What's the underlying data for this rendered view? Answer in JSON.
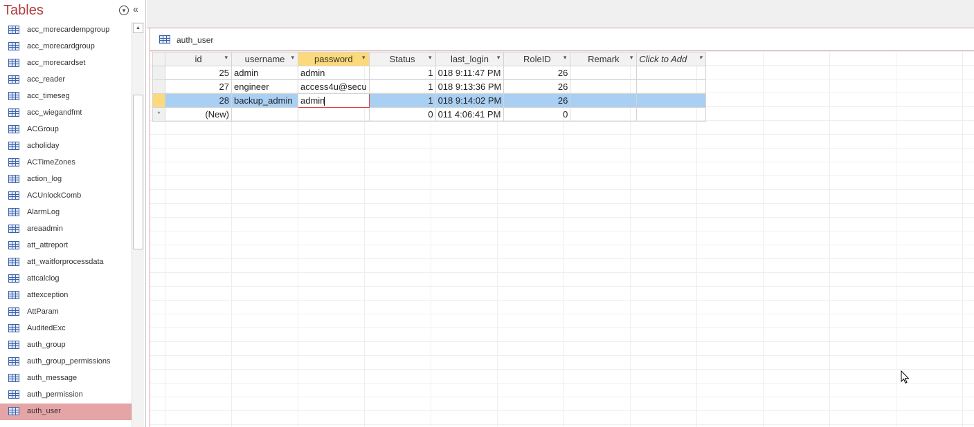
{
  "nav": {
    "title": "Tables",
    "items": [
      {
        "label": "acc_morecardempgroup"
      },
      {
        "label": "acc_morecardgroup"
      },
      {
        "label": "acc_morecardset"
      },
      {
        "label": "acc_reader"
      },
      {
        "label": "acc_timeseg"
      },
      {
        "label": "acc_wiegandfmt"
      },
      {
        "label": "ACGroup"
      },
      {
        "label": "acholiday"
      },
      {
        "label": "ACTimeZones"
      },
      {
        "label": "action_log"
      },
      {
        "label": "ACUnlockComb"
      },
      {
        "label": "AlarmLog"
      },
      {
        "label": "areaadmin"
      },
      {
        "label": "att_attreport"
      },
      {
        "label": "att_waitforprocessdata"
      },
      {
        "label": "attcalclog"
      },
      {
        "label": "attexception"
      },
      {
        "label": "AttParam"
      },
      {
        "label": "AuditedExc"
      },
      {
        "label": "auth_group"
      },
      {
        "label": "auth_group_permissions"
      },
      {
        "label": "auth_message"
      },
      {
        "label": "auth_permission"
      },
      {
        "label": "auth_user",
        "selected": true
      }
    ]
  },
  "doc": {
    "tab_label": "auth_user"
  },
  "grid": {
    "columns": [
      "id",
      "username",
      "password",
      "Status",
      "last_login",
      "RoleID",
      "Remark",
      "Click to Add"
    ],
    "rows": [
      {
        "id": "25",
        "username": "admin",
        "password": "admin",
        "status": "1",
        "last_login": "018 9:11:47 PM",
        "roleid": "26",
        "remark": ""
      },
      {
        "id": "27",
        "username": "engineer",
        "password": "access4u@secu",
        "status": "1",
        "last_login": "018 9:13:36 PM",
        "roleid": "26",
        "remark": ""
      },
      {
        "id": "28",
        "username": "backup_admin",
        "password": "admin",
        "status": "1",
        "last_login": "018 9:14:02 PM",
        "roleid": "26",
        "remark": ""
      }
    ],
    "new_row": {
      "id": "(New)",
      "status": "0",
      "last_login": "011 4:06:41 PM",
      "roleid": "0",
      "new_marker": "*"
    }
  },
  "colors": {
    "accent": "#b23a3a",
    "selected_row": "#a9cff3",
    "active_header": "#fcd97a",
    "nav_selected": "#e5a4a6"
  }
}
